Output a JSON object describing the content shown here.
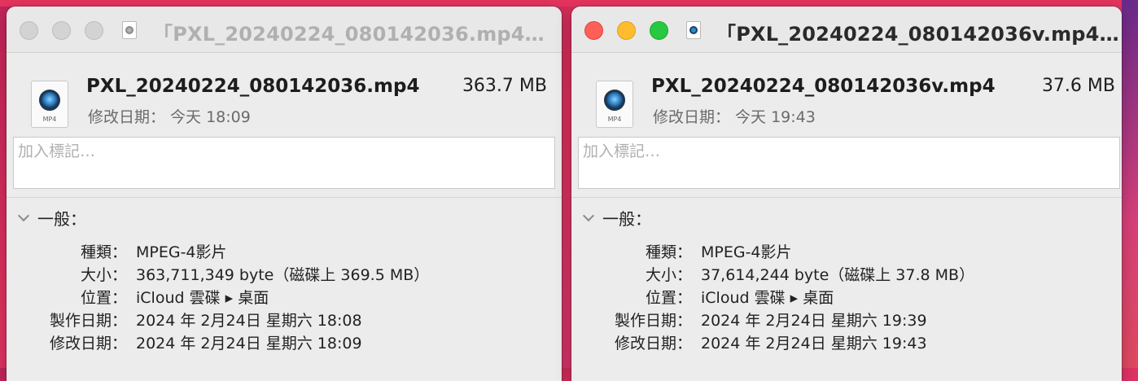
{
  "left_window": {
    "title": "「PXL_20240224_080142036.mp4…",
    "file_name": "PXL_20240224_080142036.mp4",
    "file_size": "363.7 MB",
    "modified_summary": "修改日期：  今天 18:09",
    "icon_ext": "MP4",
    "tags_placeholder": "加入標記…",
    "section_general": "一般：",
    "rows": [
      {
        "key": "種類：",
        "value": "MPEG-4影片"
      },
      {
        "key": "大小：",
        "value": "363,711,349 byte（磁碟上 369.5 MB）"
      },
      {
        "key": "位置：",
        "value": "iCloud 雲碟 ▸ 桌面"
      },
      {
        "key": "製作日期：",
        "value": "2024 年 2月24日 星期六 18:08"
      },
      {
        "key": "修改日期：",
        "value": "2024 年 2月24日 星期六 18:09"
      }
    ]
  },
  "right_window": {
    "title": "「PXL_20240224_080142036v.mp4…",
    "file_name": "PXL_20240224_080142036v.mp4",
    "file_size": "37.6 MB",
    "modified_summary": "修改日期：  今天 19:43",
    "icon_ext": "MP4",
    "tags_placeholder": "加入標記…",
    "section_general": "一般：",
    "rows": [
      {
        "key": "種類：",
        "value": "MPEG-4影片"
      },
      {
        "key": "大小：",
        "value": "37,614,244 byte（磁碟上 37.8 MB）"
      },
      {
        "key": "位置：",
        "value": "iCloud 雲碟 ▸ 桌面"
      },
      {
        "key": "製作日期：",
        "value": "2024 年 2月24日 星期六 19:39"
      },
      {
        "key": "修改日期：",
        "value": "2024 年 2月24日 星期六 19:43"
      }
    ]
  },
  "colors": {
    "close": "#fe5f57",
    "minimize": "#febc2e",
    "zoom": "#28c840",
    "inactive_light": "#d3d3d3"
  },
  "icons": {
    "file": "quicktime-movie-icon",
    "disclosure": "chevron-down-icon"
  }
}
